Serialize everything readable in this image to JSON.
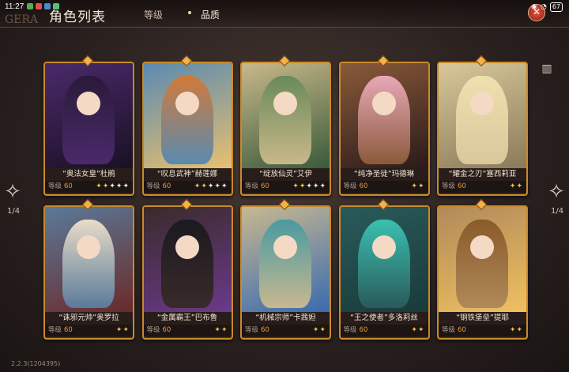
{
  "status": {
    "time": "11:27",
    "battery": "67"
  },
  "header": {
    "title": "角色列表",
    "deco": "GERA",
    "tabs": [
      {
        "label": "等级"
      },
      {
        "label": "品质"
      }
    ]
  },
  "level_label": "等级",
  "pager": {
    "left": "1/4",
    "right": "1/4"
  },
  "version": "2.2.3(1204395)",
  "cards": [
    {
      "name": "“奥法女皇”杜鹃",
      "level": "60",
      "stars": 5,
      "lit": 2,
      "colors": [
        "#4a2a6a",
        "#2a1a3a",
        "#1a1024"
      ]
    },
    {
      "name": "“叹息武神”赫莲娜",
      "level": "60",
      "stars": 5,
      "lit": 2,
      "colors": [
        "#5a8ab0",
        "#d07a3a",
        "#e8c070"
      ]
    },
    {
      "name": "“绽放仙灵”艾伊",
      "level": "60",
      "stars": 5,
      "lit": 2,
      "colors": [
        "#c9b88a",
        "#6a8a5a",
        "#3a5a3a"
      ]
    },
    {
      "name": "“纯净圣徒”玛德琳",
      "level": "60",
      "stars": 2,
      "lit": 2,
      "colors": [
        "#8a5a3a",
        "#e8a8b8",
        "#2a1a1a"
      ]
    },
    {
      "name": "“耀金之刃”塞西莉亚",
      "level": "60",
      "stars": 2,
      "lit": 2,
      "colors": [
        "#d8c89a",
        "#f0e0b0",
        "#8a7a5a"
      ]
    },
    {
      "name": "“诛邪元帅”奥罗拉",
      "level": "60",
      "stars": 2,
      "lit": 2,
      "colors": [
        "#5a7a9a",
        "#e8dcc8",
        "#6a2a2a"
      ]
    },
    {
      "name": "“金属霸王”巴布鲁",
      "level": "60",
      "stars": 2,
      "lit": 2,
      "colors": [
        "#3a2a2a",
        "#1a1a20",
        "#6a3a8a"
      ]
    },
    {
      "name": "“机械宗师”卡茜妲",
      "level": "60",
      "stars": 2,
      "lit": 2,
      "colors": [
        "#c8b890",
        "#4a9aa0",
        "#3a6ab0"
      ]
    },
    {
      "name": "“王之使者”多洛莉丝",
      "level": "60",
      "stars": 2,
      "lit": 2,
      "colors": [
        "#2a5a5a",
        "#3ac0b0",
        "#1a3a3a"
      ]
    },
    {
      "name": "“钢铁堡垒”提耶",
      "level": "60",
      "stars": 2,
      "lit": 2,
      "colors": [
        "#b08a5a",
        "#8a5a2a",
        "#f0c060"
      ]
    }
  ],
  "icons": {
    "close": "close-icon",
    "filter": "filter-icon",
    "prev": "arrow-left-icon",
    "next": "arrow-right-icon"
  }
}
